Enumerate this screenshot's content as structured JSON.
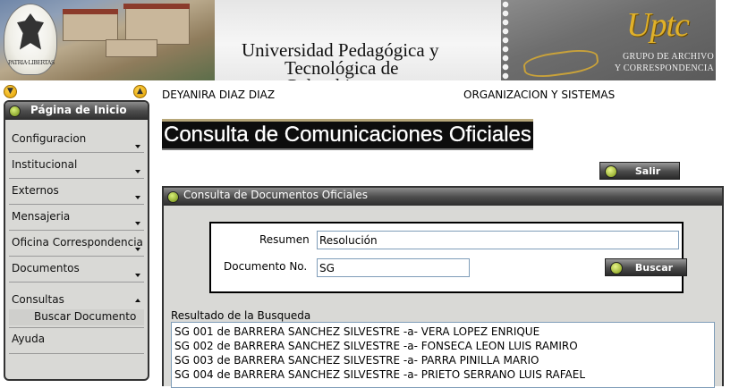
{
  "header": {
    "crest_motto": "PATRIA·LIBERTAS",
    "university_line1": "Universidad Pedagógica y",
    "university_line2": "Tecnológica de Colombia",
    "logo_text": "Uptc",
    "stamp_line1": "GRUPO DE ARCHIVO",
    "stamp_line2": "Y CORRESPONDENCIA"
  },
  "sidebar": {
    "title": "Página de Inicio",
    "items": [
      {
        "label": "Configuracion"
      },
      {
        "label": "Institucional"
      },
      {
        "label": "Externos"
      },
      {
        "label": "Mensajeria"
      },
      {
        "label": "Oficina Correspondencia"
      },
      {
        "label": "Documentos"
      },
      {
        "label": "Consultas"
      },
      {
        "label": "Ayuda"
      }
    ],
    "subitem": "Buscar Documento"
  },
  "user": {
    "name": "DEYANIRA DIAZ DIAZ",
    "department": "ORGANIZACION Y SISTEMAS"
  },
  "page": {
    "title": "Consulta de Comunicaciones Oficiales",
    "exit_label": "Salir"
  },
  "panel": {
    "title": "Consulta de Documentos Oficiales",
    "resumen_label": "Resumen",
    "resumen_value": "Resolución",
    "documento_label": "Documento No.",
    "documento_value": "SG",
    "search_label": "Buscar",
    "results_label": "Resultado de la Busqueda",
    "results": [
      "SG 001 de BARRERA SANCHEZ SILVESTRE -a- VERA LOPEZ ENRIQUE",
      "SG 002 de BARRERA SANCHEZ SILVESTRE -a- FONSECA LEON LUIS RAMIRO",
      "SG 003 de BARRERA SANCHEZ SILVESTRE -a- PARRA PINILLA MARIO",
      "SG 004 de BARRERA SANCHEZ SILVESTRE -a- PRIETO SERRANO LUIS RAFAEL"
    ]
  },
  "colors": {
    "accent_gold": "#e0b12a",
    "header_dark": "#2d2d2d",
    "panel_bg": "#d9d9d6",
    "indicator_green": "#7d9812"
  }
}
